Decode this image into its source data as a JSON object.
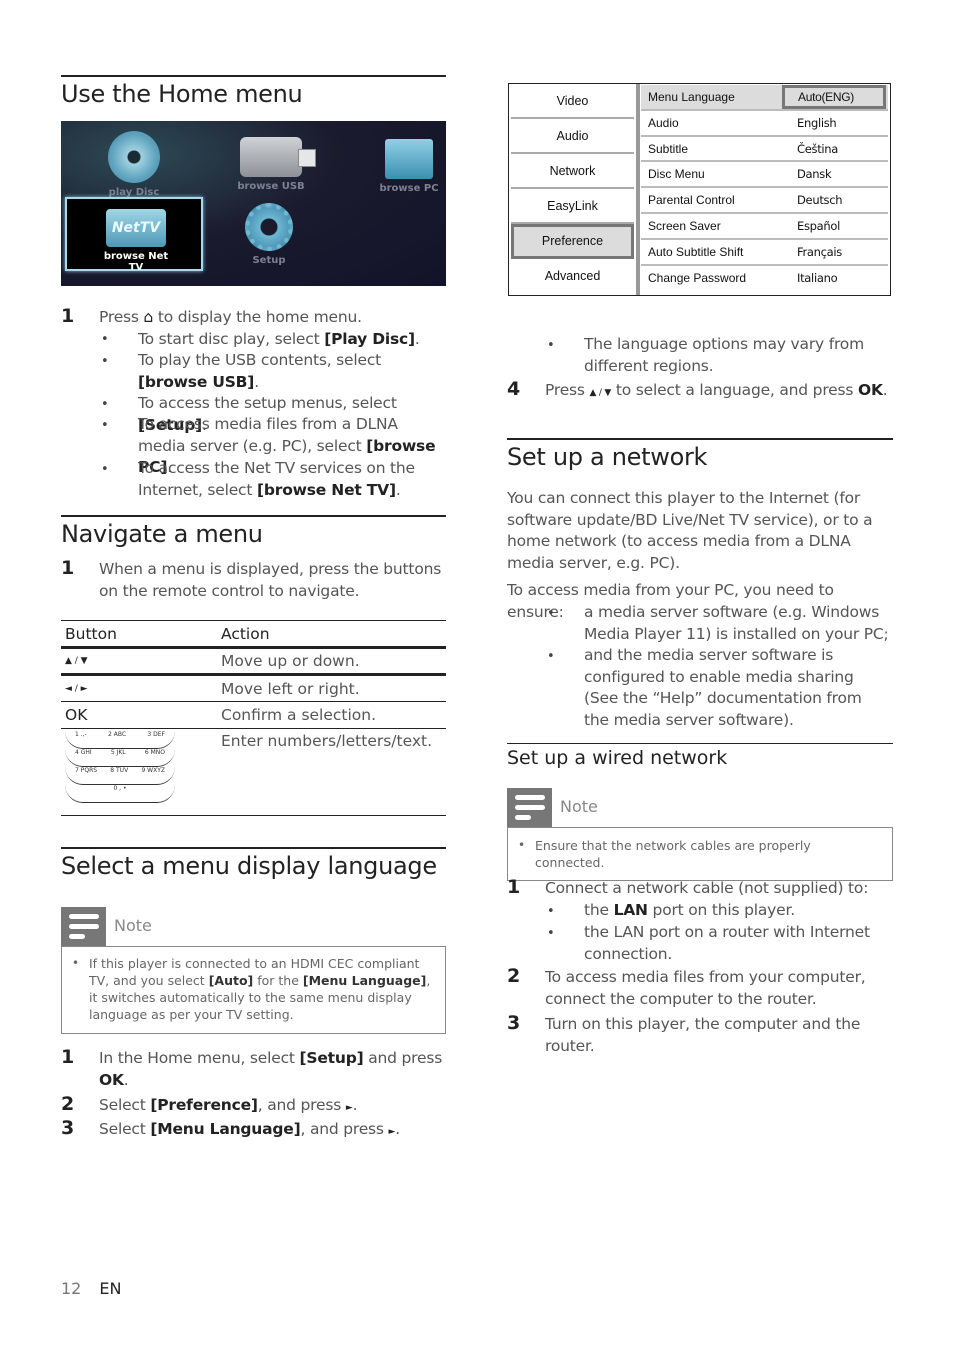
{
  "left": {
    "home": {
      "title": "Use the Home menu",
      "menu_tiles": [
        "play Disc",
        "browse USB",
        "browse PC",
        "NetTV",
        "browse Net TV",
        "Setup"
      ],
      "step1": {
        "num": "1",
        "pre": "Press",
        "icon": "home-icon",
        "post": "to display the home menu."
      },
      "bullets": [
        {
          "text": "To start disc play, select ",
          "bold": "[Play Disc]",
          "end": "."
        },
        {
          "text": "To play the USB contents, select ",
          "bold": "[browse USB]",
          "end": "."
        },
        {
          "text": "To access the setup menus, select ",
          "bold": "[Setup]",
          "end": "."
        },
        {
          "text": "To access media files from a DLNA media server (e.g. PC), select ",
          "bold": "[browse PC]",
          "end": "."
        },
        {
          "text": "To access the Net TV services on the Internet, select ",
          "bold": "[browse Net TV]",
          "end": "."
        }
      ]
    },
    "navigate": {
      "title": "Navigate a menu",
      "step1": {
        "num": "1",
        "text": "When a menu is displayed, press the buttons on the remote control to navigate."
      },
      "table": {
        "headers": [
          "Button",
          "Action"
        ],
        "rows": [
          {
            "button": "▲ / ▼",
            "action": "Move up or down."
          },
          {
            "button": "◄ / ►",
            "action": "Move left or right."
          },
          {
            "button": "OK",
            "action": "Confirm a selection."
          },
          {
            "button": "keypad",
            "action": "Enter numbers/letters/text."
          }
        ],
        "keypad": [
          [
            "1 .,-",
            "2 ABC",
            "3 DEF"
          ],
          [
            "4 GHI",
            "5 JKL",
            "6 MNO"
          ],
          [
            "7 PQRS",
            "8 TUV",
            "9 WXYZ"
          ],
          [
            "",
            "0 , •",
            ""
          ]
        ]
      }
    },
    "language": {
      "title": "Select a menu display language",
      "note_label": "Note",
      "note_pre": "If this player is connected to an HDMI CEC compliant TV, and you select ",
      "note_bold1": "[Auto]",
      "note_mid": " for the ",
      "note_bold2": "[Menu Language]",
      "note_post": ", it switches automatically to the same menu display language as per your TV setting.",
      "steps": [
        {
          "num": "1",
          "pre": "In the Home menu, select ",
          "bold": "[Setup]",
          "post": " and press ",
          "bold2": "OK",
          "end": "."
        },
        {
          "num": "2",
          "pre": "Select ",
          "bold": "[Preference]",
          "post": ", and press ",
          "arrow": "►",
          "end": "."
        },
        {
          "num": "3",
          "pre": "Select ",
          "bold": "[Menu Language]",
          "post": ", and press ",
          "arrow": "►",
          "end": "."
        }
      ]
    }
  },
  "right": {
    "setup_menu": {
      "categories": [
        "Video",
        "Audio",
        "Network",
        "EasyLink",
        "Preference",
        "Advanced"
      ],
      "active_category": "Preference",
      "items": [
        {
          "label": "Menu Language",
          "value": "Auto(ENG)"
        },
        {
          "label": "Audio",
          "value": "English"
        },
        {
          "label": "Subtitle",
          "value": "Čeština"
        },
        {
          "label": "Disc Menu",
          "value": "Dansk"
        },
        {
          "label": "Parental Control",
          "value": "Deutsch"
        },
        {
          "label": "Screen Saver",
          "value": "Español"
        },
        {
          "label": "Auto Subtitle Shift",
          "value": "Français"
        },
        {
          "label": "Change Password",
          "value": "Italiano"
        }
      ]
    },
    "lang_bullet": "The language options may vary from different regions.",
    "step4": {
      "num": "4",
      "pre": "Press",
      "arrows": "▲ / ▼",
      "post": "to select a language, and press",
      "bold": "OK",
      "end": "."
    },
    "network": {
      "title": "Set up a network",
      "intro": "You can connect this player to the Internet (for software update/BD Live/Net TV service), or to a home network (to access media from a DLNA media server, e.g. PC).",
      "ensure": "To access media from your PC, you need to ensure:",
      "bullets": [
        "a media server software (e.g. Windows Media Player 11) is installed on your PC;",
        "and the media server software is configured to enable media sharing (See the “Help” documentation from the media server software)."
      ]
    },
    "wired": {
      "title": "Set up a wired network",
      "note_label": "Note",
      "note_text": "Ensure that the network cables are properly connected.",
      "step1": {
        "num": "1",
        "text": "Connect a network cable (not supplied) to:"
      },
      "step1_bullets": [
        {
          "pre": "the ",
          "bold": "LAN",
          "post": " port on this player."
        },
        {
          "pre": "the LAN port on a router with Internet connection.",
          "bold": "",
          "post": ""
        }
      ],
      "step2": {
        "num": "2",
        "text": "To access media files from your computer, connect the computer to the router."
      },
      "step3": {
        "num": "3",
        "text": "Turn on this player, the computer and the router."
      }
    }
  },
  "footer": {
    "page": "12",
    "lang": "EN"
  }
}
